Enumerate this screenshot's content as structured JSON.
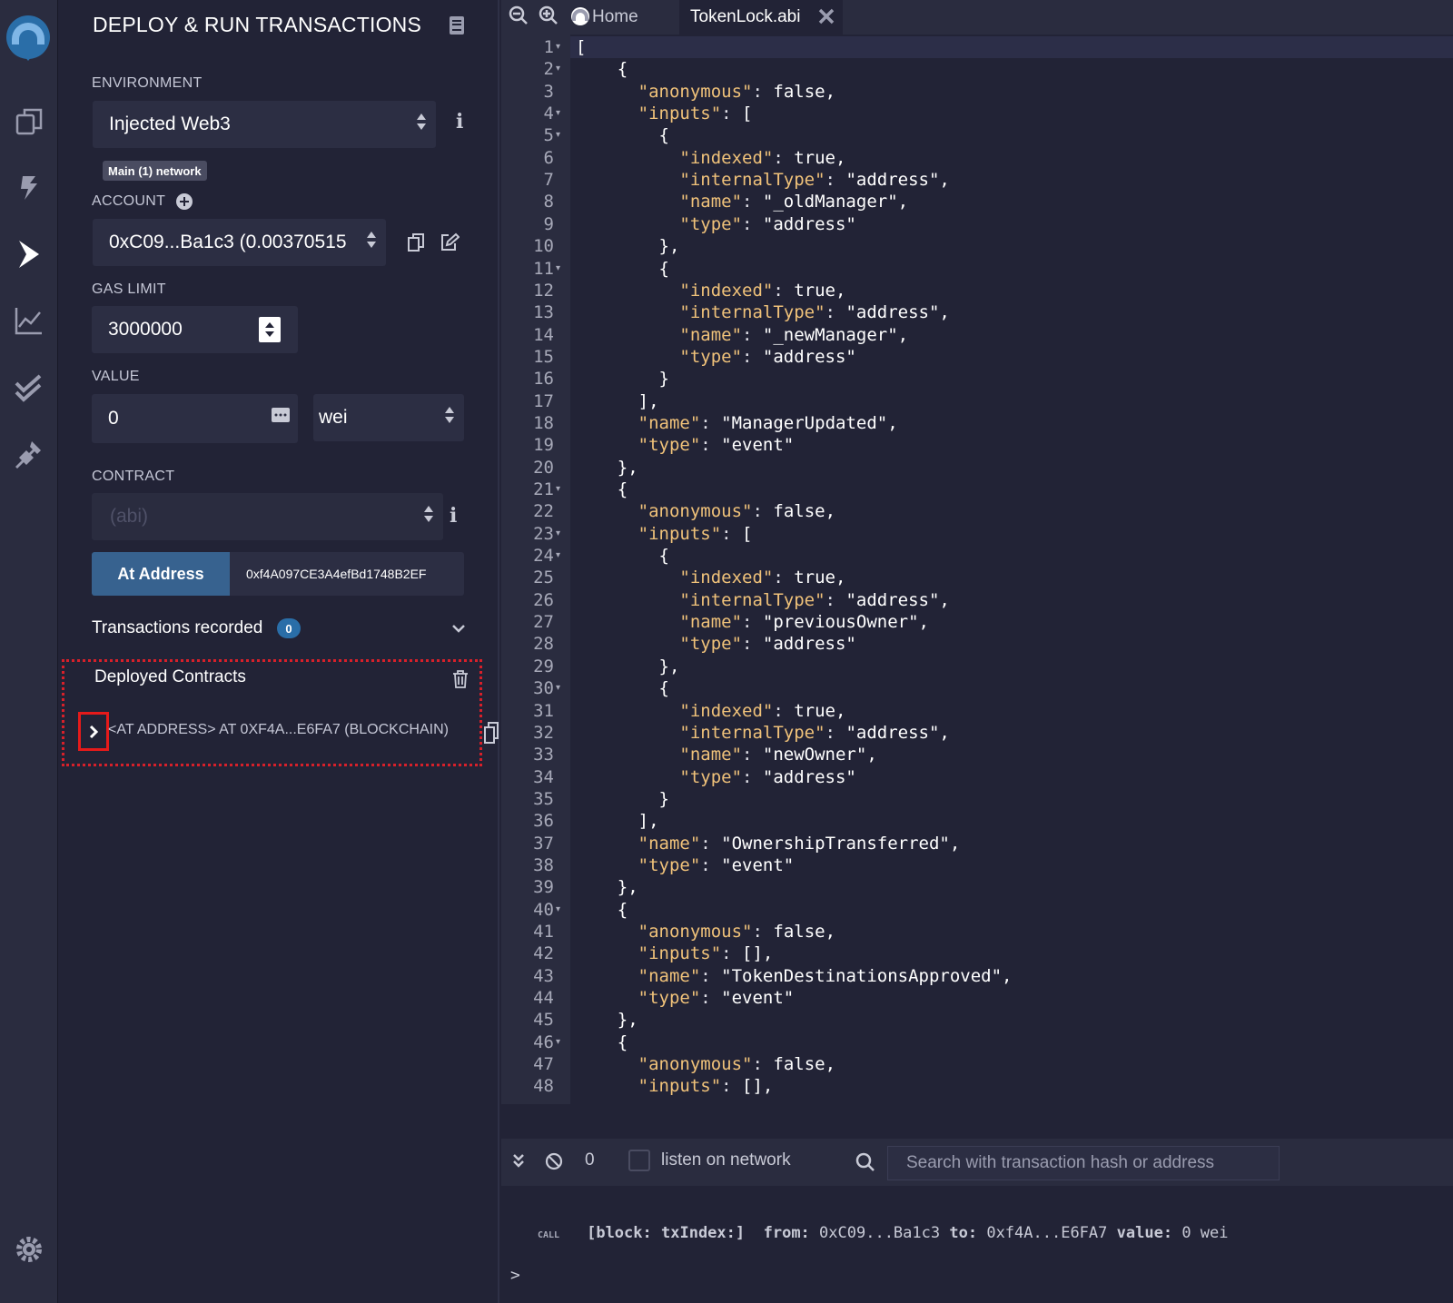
{
  "panel": {
    "title": "DEPLOY & RUN TRANSACTIONS",
    "environment_label": "ENVIRONMENT",
    "environment_value": "Injected Web3",
    "network_badge": "Main (1) network",
    "account_label": "ACCOUNT",
    "account_value": "0xC09...Ba1c3 (0.00370515",
    "gas_label": "GAS LIMIT",
    "gas_value": "3000000",
    "value_label": "VALUE",
    "value_amount": "0",
    "value_unit": "wei",
    "contract_label": "CONTRACT",
    "contract_placeholder": "(abi)",
    "at_address_button": "At Address",
    "at_address_value": "0xf4A097CE3A4efBd1748B2EF",
    "tx_recorded_label": "Transactions recorded",
    "tx_recorded_count": "0",
    "deployed_label": "Deployed Contracts",
    "deployed_item": "<AT ADDRESS> AT 0XF4A...E6FA7 (BLOCKCHAIN)"
  },
  "editor": {
    "home_tab": "Home",
    "file_tab": "TokenLock.abi",
    "fold_lines": [
      1,
      2,
      4,
      5,
      11,
      21,
      23,
      24,
      30,
      40,
      46
    ],
    "lines": [
      "[",
      "    {",
      "      \"anonymous\": false,",
      "      \"inputs\": [",
      "        {",
      "          \"indexed\": true,",
      "          \"internalType\": \"address\",",
      "          \"name\": \"_oldManager\",",
      "          \"type\": \"address\"",
      "        },",
      "        {",
      "          \"indexed\": true,",
      "          \"internalType\": \"address\",",
      "          \"name\": \"_newManager\",",
      "          \"type\": \"address\"",
      "        }",
      "      ],",
      "      \"name\": \"ManagerUpdated\",",
      "      \"type\": \"event\"",
      "    },",
      "    {",
      "      \"anonymous\": false,",
      "      \"inputs\": [",
      "        {",
      "          \"indexed\": true,",
      "          \"internalType\": \"address\",",
      "          \"name\": \"previousOwner\",",
      "          \"type\": \"address\"",
      "        },",
      "        {",
      "          \"indexed\": true,",
      "          \"internalType\": \"address\",",
      "          \"name\": \"newOwner\",",
      "          \"type\": \"address\"",
      "        }",
      "      ],",
      "      \"name\": \"OwnershipTransferred\",",
      "      \"type\": \"event\"",
      "    },",
      "    {",
      "      \"anonymous\": false,",
      "      \"inputs\": [],",
      "      \"name\": \"TokenDestinationsApproved\",",
      "      \"type\": \"event\"",
      "    },",
      "    {",
      "      \"anonymous\": false,",
      "      \"inputs\": [],"
    ]
  },
  "terminal": {
    "pending_count": "0",
    "listen_label": "listen on network",
    "search_placeholder": "Search with transaction hash or address",
    "log_tag": "CALL",
    "log_block": "[block:",
    "log_txindex": "txIndex:]",
    "log_from_label": "from:",
    "log_from": "0xC09...Ba1c3",
    "log_to_label": "to:",
    "log_to": "0xf4A...E6FA7",
    "log_value_label": "value:",
    "log_value": "0 wei",
    "prompt": ">"
  },
  "colors": {
    "background": "#222336",
    "rail": "#2a2c3f",
    "json_key": "#f0c27a",
    "accent_button": "#37628f",
    "highlight_red": "#d7202a"
  }
}
